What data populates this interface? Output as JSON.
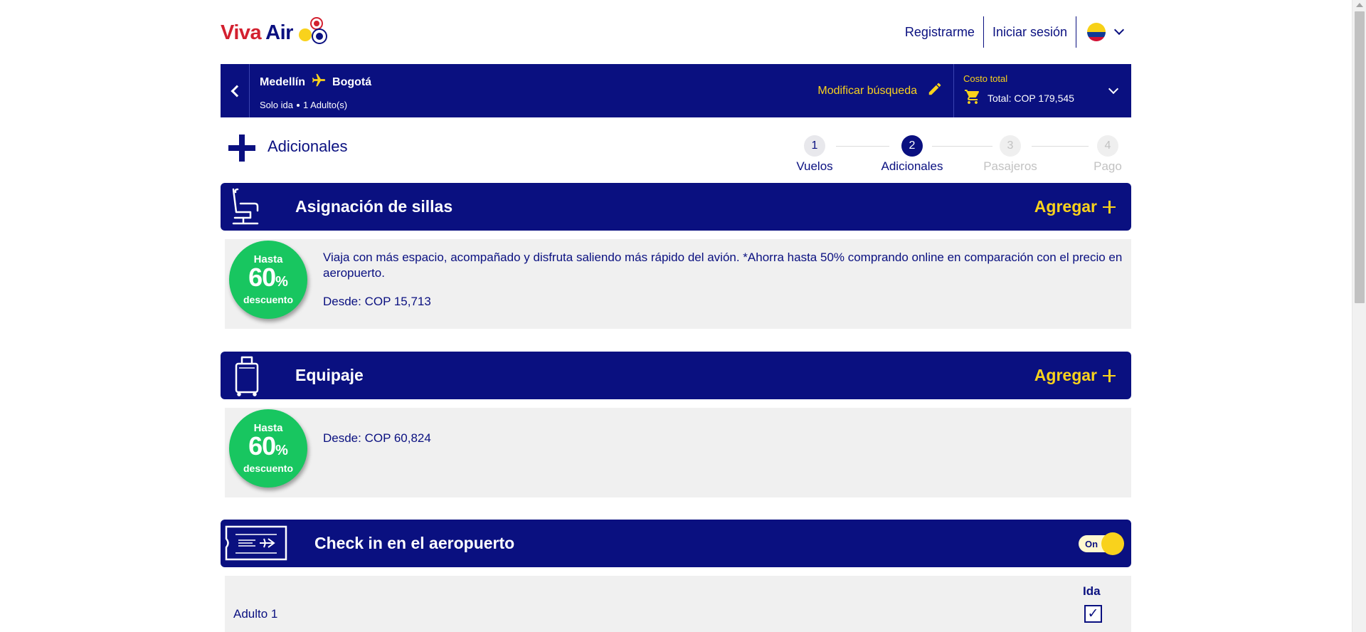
{
  "header": {
    "logo_viva": "Viva",
    "logo_air": "Air",
    "register": "Registrarme",
    "login": "Iniciar sesión"
  },
  "search": {
    "origin": "Medellín",
    "destination": "Bogotá",
    "trip_type": "Solo ida",
    "passengers": "1 Adulto(s)",
    "modify": "Modificar búsqueda",
    "total_label": "Costo total",
    "total_value": "Total: COP 179,545"
  },
  "section": {
    "title": "Adicionales"
  },
  "stepper": [
    {
      "num": "1",
      "label": "Vuelos",
      "state": "done"
    },
    {
      "num": "2",
      "label": "Adicionales",
      "state": "active"
    },
    {
      "num": "3",
      "label": "Pasajeros",
      "state": "todo"
    },
    {
      "num": "4",
      "label": "Pago",
      "state": "todo"
    }
  ],
  "seats": {
    "title": "Asignación de sillas",
    "add": "Agregar",
    "badge_top": "Hasta",
    "badge_num": "60",
    "badge_pct": "%",
    "badge_bottom": "descuento",
    "description": "Viaja con más espacio, acompañado y disfruta saliendo más rápido del avión. *Ahorra hasta 50% comprando online en comparación con el precio en aeropuerto.",
    "price": "Desde: COP 15,713"
  },
  "luggage": {
    "title": "Equipaje",
    "add": "Agregar",
    "badge_top": "Hasta",
    "badge_num": "60",
    "badge_pct": "%",
    "badge_bottom": "descuento",
    "price": "Desde: COP 60,824"
  },
  "checkin": {
    "title": "Check in en el aeropuerto",
    "toggle_label": "On",
    "column": "Ida",
    "passenger": "Adulto 1",
    "checked": "✓"
  },
  "colors": {
    "brand_blue": "#0a1080",
    "accent_yellow": "#f9d21c",
    "badge_green": "#18c660",
    "logo_red": "#d3202f"
  },
  "icons": [
    "plane-icon",
    "pencil-icon",
    "cart-icon",
    "seat-icon",
    "suitcase-icon",
    "ticket-icon",
    "chevron-down-icon",
    "chevron-left-icon",
    "plus-icon"
  ]
}
